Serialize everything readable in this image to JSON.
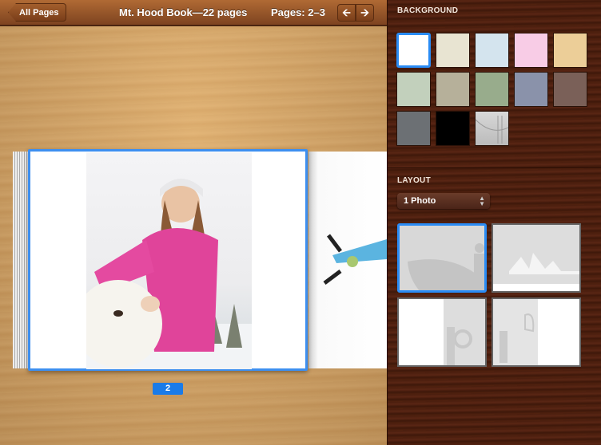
{
  "toolbar": {
    "back_label": "All Pages",
    "title": "Mt. Hood Book—22 pages",
    "pages": "Pages: 2–3",
    "prev_icon": "arrow-left",
    "next_icon": "arrow-right"
  },
  "book": {
    "page_number": "2"
  },
  "panel": {
    "background_title": "BACKGROUND",
    "swatches": [
      "#ffffff",
      "#e8e4d2",
      "#d4e4ee",
      "#f8cce6",
      "#ecce98",
      "#c2d0bc",
      "#b6b09a",
      "#98ac8c",
      "#8a92aa",
      "#7a6058",
      "#6c7074",
      "#000000",
      "photo"
    ],
    "selected_swatch": 0,
    "layout_title": "LAYOUT",
    "layout_value": "1 Photo",
    "selected_layout": 0
  },
  "colors": {
    "accent": "#2a8cf5"
  }
}
